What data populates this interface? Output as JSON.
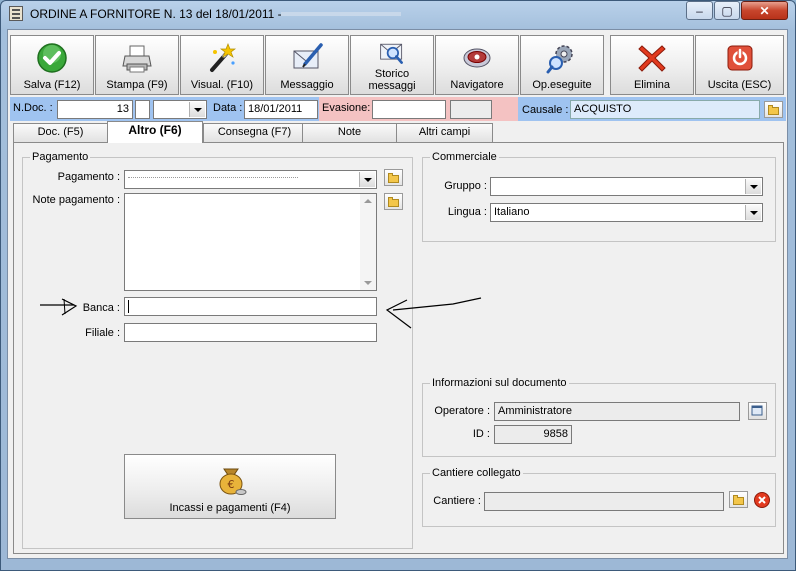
{
  "window": {
    "title": "ORDINE A FORNITORE N. 13  del 18/01/2011 -",
    "controls": {
      "minimize": "–",
      "maximize": "▢",
      "close": "✕"
    }
  },
  "toolbar": {
    "buttons": [
      {
        "label": "Salva (F12)",
        "icon": "check-icon",
        "color": "#2e9e2e"
      },
      {
        "label": "Stampa (F9)",
        "icon": "printer-icon"
      },
      {
        "label": "Visual. (F10)",
        "icon": "magic-wand-icon"
      },
      {
        "label": "Messaggio",
        "icon": "envelope-pen-icon"
      },
      {
        "label": "Storico messaggi",
        "icon": "envelope-search-icon"
      },
      {
        "label": "Navigatore",
        "icon": "navigator-icon"
      },
      {
        "label": "Op.eseguite",
        "icon": "gears-search-icon"
      },
      {
        "label": "Elimina",
        "icon": "red-x-icon",
        "color": "#e23a1f"
      },
      {
        "label": "Uscita (ESC)",
        "icon": "exit-icon",
        "color": "#e0503a"
      }
    ]
  },
  "infobar": {
    "ndoc_label": "N.Doc. :",
    "ndoc_value": "13",
    "data_label": "Data :",
    "data_value": "18/01/2011",
    "evasione_label": "Evasione:",
    "evasione_value": "",
    "causale_label": "Causale :",
    "causale_value": "ACQUISTO"
  },
  "tabs": [
    {
      "label": "Doc. (F5)",
      "active": false
    },
    {
      "label": "Altro (F6)",
      "active": true
    },
    {
      "label": "Consegna (F7)",
      "active": false
    },
    {
      "label": "Note",
      "active": false
    },
    {
      "label": "Altri campi",
      "active": false
    }
  ],
  "pagamento": {
    "group_title": "Pagamento",
    "pagamento_label": "Pagamento :",
    "pagamento_value": "",
    "note_label": "Note pagamento :",
    "note_value": "",
    "banca_label": "Banca :",
    "banca_value": "",
    "filiale_label": "Filiale :",
    "filiale_value": "",
    "incassi_button": "Incassi e pagamenti (F4)"
  },
  "commerciale": {
    "group_title": "Commerciale",
    "gruppo_label": "Gruppo :",
    "gruppo_value": "",
    "lingua_label": "Lingua :",
    "lingua_value": "Italiano"
  },
  "info_documento": {
    "group_title": "Informazioni sul documento",
    "operatore_label": "Operatore :",
    "operatore_value": "Amministratore",
    "id_label": "ID :",
    "id_value": "9858"
  },
  "cantiere": {
    "group_title": "Cantiere collegato",
    "cantiere_label": "Cantiere :",
    "cantiere_value": ""
  },
  "colors": {
    "infobar_bg": "#9fc3f0",
    "evasione_bg": "#f4c2c2",
    "window_frame": "#b9d1ea"
  }
}
